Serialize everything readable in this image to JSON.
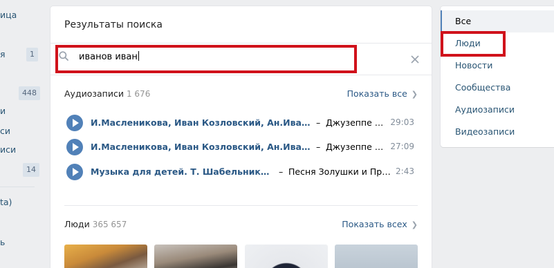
{
  "left_nav": {
    "items": [
      {
        "label": "ица"
      },
      {
        "label": "я"
      },
      {
        "label": "и"
      },
      {
        "label": "си"
      },
      {
        "label": "иси"
      },
      {
        "label": "ta)"
      },
      {
        "label": "ь"
      }
    ],
    "badges": [
      "1",
      "448",
      "14"
    ]
  },
  "search": {
    "header": "Результаты поиска",
    "query": "иванов иван"
  },
  "audio": {
    "title": "Аудиозаписи",
    "count": "1 676",
    "show_all": "Показать все",
    "tracks": [
      {
        "artist": "И.Масленикова, Иван Козловский, Ан.Иванов, С.С...",
        "song": "Джузеппе Ве...",
        "duration": "29:03"
      },
      {
        "artist": "И.Масленикова, Иван Козловский, Ан.Иванов, С.С...",
        "song": "Джузеппе Ве...",
        "duration": "27:09"
      },
      {
        "artist": "Музыка для детей. Т. Шабельникова, И. ...",
        "song": "Песня Золушки и Прин...",
        "duration": "2:43"
      }
    ]
  },
  "people": {
    "title": "Люди",
    "count": "365 657",
    "show_all": "Показать всех"
  },
  "filters": {
    "items": [
      {
        "label": "Все",
        "active": true
      },
      {
        "label": "Люди",
        "active": false
      },
      {
        "label": "Новости",
        "active": false
      },
      {
        "label": "Сообщества",
        "active": false
      },
      {
        "label": "Аудиозаписи",
        "active": false
      },
      {
        "label": "Видеозаписи",
        "active": false
      }
    ]
  },
  "colors": {
    "accent": "#5181b8",
    "link": "#2a5885",
    "highlight": "#d0121b"
  }
}
